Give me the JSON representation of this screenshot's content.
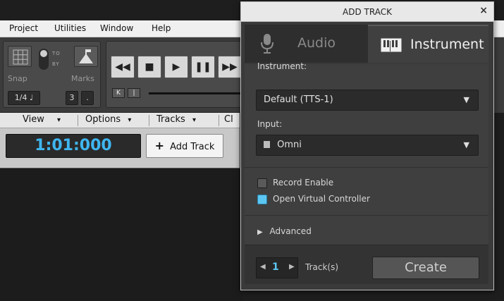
{
  "menubar": {
    "items": [
      "Project",
      "Utilities",
      "Window",
      "Help"
    ]
  },
  "snap_module": {
    "snap_label": "Snap",
    "marks_label": "Marks",
    "toggle_top": "TO",
    "toggle_bottom": "BY",
    "value": "1/4",
    "note": "♩",
    "sub": "3",
    "dot": "."
  },
  "transport": {
    "rewind": "◀◀",
    "stop": "■",
    "play": "▶",
    "pause": "❚❚",
    "ff": "▶▶",
    "loop_start": "K",
    "loop_marker": "|"
  },
  "toolbar2": {
    "items": [
      "View",
      "Options",
      "Tracks",
      "Cl"
    ],
    "caret": "▾"
  },
  "time_display": "1:01:000",
  "add_track_button": {
    "icon": "+",
    "label": "Add Track"
  },
  "dialog": {
    "title": "ADD TRACK",
    "close": "×",
    "tabs": [
      {
        "label": "Audio",
        "icon": "microphone-icon",
        "active": false
      },
      {
        "label": "Instrument",
        "icon": "piano-icon",
        "active": true
      }
    ],
    "instrument_label": "Instrument:",
    "instrument_value": "Default (TTS-1)",
    "input_label": "Input:",
    "input_value": "Omni",
    "dropdown_arrow": "▼",
    "record_enable": {
      "label": "Record Enable",
      "checked": false
    },
    "open_vc": {
      "label": "Open Virtual Controller",
      "checked": true
    },
    "advanced": {
      "arrow": "▶",
      "label": "Advanced"
    },
    "track_count": {
      "left": "◀",
      "value": "1",
      "right": "▶",
      "suffix": "Track(s)"
    },
    "create_label": "Create"
  },
  "colors": {
    "accent": "#5cc6f2",
    "time_color": "#3fb6f0"
  }
}
